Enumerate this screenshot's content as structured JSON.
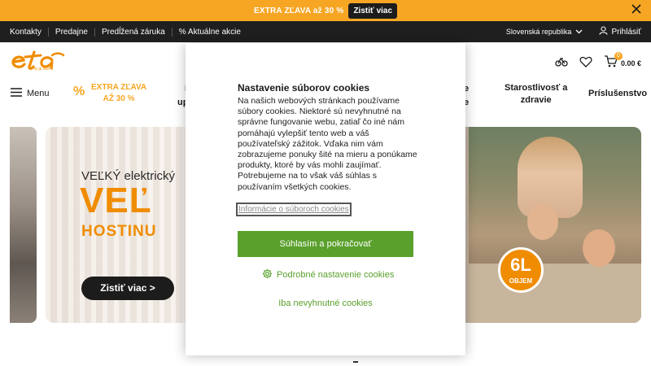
{
  "promo_bar": {
    "text": "EXTRA ZĽAVA až 30 %",
    "button_label": "Zistiť viac",
    "close_icon": "close-icon"
  },
  "top_nav": {
    "links": [
      "Kontakty",
      "Predajne",
      "Predĺžená záruka",
      "% Aktuálne akcie"
    ],
    "country": "Slovenská republika",
    "login": "Prihlásiť"
  },
  "header": {
    "logo_text": "eta",
    "logo_tagline": "to je doma",
    "icons": [
      "compare-icon",
      "heart-icon",
      "cart-icon"
    ],
    "cart_count": "0",
    "cart_total": "0.00 €"
  },
  "main_menu": {
    "menu_label": "Menu",
    "promo_symbol": "%",
    "promo_line1": "EXTRA ZĽAVA",
    "promo_line2": "AŽ 30 %",
    "cut_left_line1": "I",
    "cut_left_line2": "up",
    "cut_right_line1": "e",
    "cut_right_line2": "e",
    "care_line1": "Starostlivosť a",
    "care_line2": "zdravie",
    "accessories": "Príslušenstvo"
  },
  "hero": {
    "kicker": "VEĽKÝ elektrický",
    "headline": "VEĽ",
    "subline": "HOSTINU",
    "cta_label": "Zistiť viac >",
    "volume_value": "6L",
    "volume_label": "OBJEM"
  },
  "cookie_modal": {
    "title": "Nastavenie súborov cookies",
    "body": "Na našich webových stránkach používame súbory cookies. Niektoré sú nevyhnutné na správne fungovanie webu, zatiaľ čo iné nám pomáhajú vylepšiť tento web a váš používateľský zážitok. Vďaka nim vám zobrazujeme ponuky šité na mieru a ponúkame produkty, ktoré by vás mohli zaujímať. Potrebujeme na to však váš súhlas s používaním všetkých cookies.",
    "info_link": "Informácie o súboroch cookies",
    "accept_label": "Súhlasím a pokračovať",
    "detail_label": "Podrobné nastavenie cookies",
    "detail_icon": "gear-icon",
    "necessary_label": "Iba nevyhnutné cookies"
  },
  "colors": {
    "accent_orange": "#f6a623",
    "brand_orange": "#f08c00",
    "cookie_green": "#5aa02c",
    "dark_bar": "#1f1f1f"
  }
}
